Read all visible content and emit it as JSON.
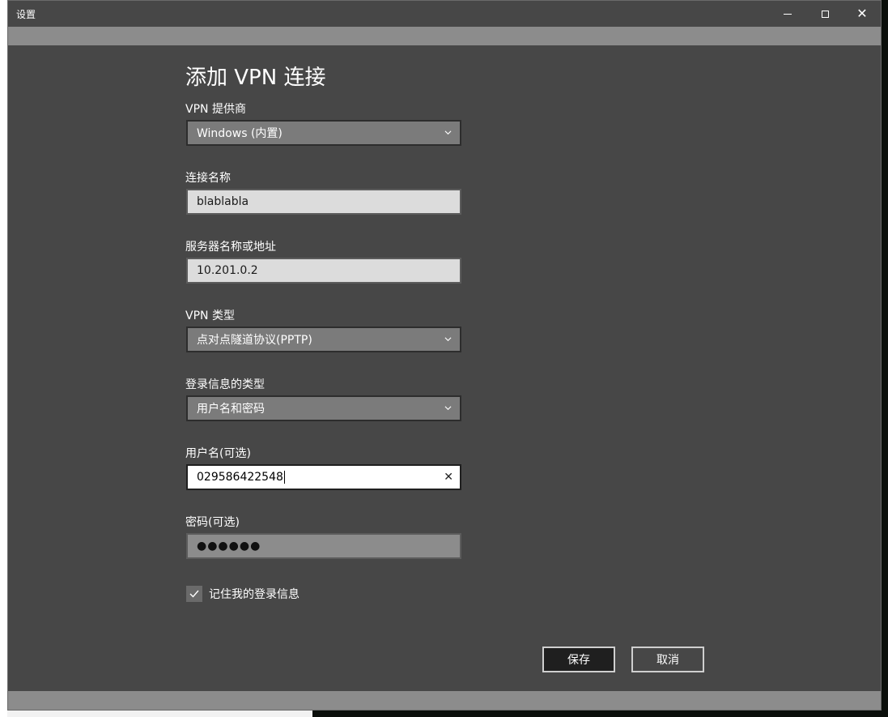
{
  "window": {
    "title": "设置"
  },
  "form": {
    "heading": "添加 VPN 连接",
    "provider": {
      "label": "VPN 提供商",
      "value": "Windows (内置)"
    },
    "connection_name": {
      "label": "连接名称",
      "value": "blablabla"
    },
    "server": {
      "label": "服务器名称或地址",
      "value": "10.201.0.2"
    },
    "vpn_type": {
      "label": "VPN 类型",
      "value": "点对点隧道协议(PPTP)"
    },
    "signin_type": {
      "label": "登录信息的类型",
      "value": "用户名和密码"
    },
    "username": {
      "label": "用户名(可选)",
      "value": "029586422548"
    },
    "password": {
      "label": "密码(可选)",
      "value": "●●●●●●"
    },
    "remember": {
      "label": "记住我的登录信息",
      "checked": true
    }
  },
  "buttons": {
    "save": "保存",
    "cancel": "取消"
  },
  "icons": {
    "minimize": "minimize-icon",
    "maximize": "maximize-icon",
    "close": "close-icon",
    "dropdown": "chevron-down-icon",
    "clear": "clear-icon",
    "check": "checkmark-icon"
  },
  "colors": {
    "window_bg": "#474747",
    "strip": "#8c8c8c",
    "select_bg": "#7b7b7b",
    "input_bg": "#dcdcdc"
  }
}
